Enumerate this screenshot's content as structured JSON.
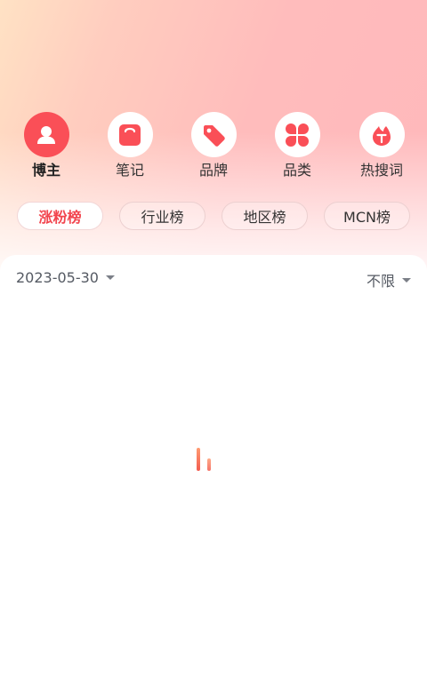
{
  "categories": [
    {
      "label": "博主",
      "icon": "user-icon",
      "active": true
    },
    {
      "label": "笔记",
      "icon": "note-icon",
      "active": false
    },
    {
      "label": "品牌",
      "icon": "tag-icon",
      "active": false
    },
    {
      "label": "品类",
      "icon": "clover-icon",
      "active": false
    },
    {
      "label": "热搜词",
      "icon": "hot-search-icon",
      "active": false
    }
  ],
  "sub_tabs": [
    {
      "label": "涨粉榜",
      "active": true
    },
    {
      "label": "行业榜",
      "active": false
    },
    {
      "label": "地区榜",
      "active": false
    },
    {
      "label": "MCN榜",
      "active": false
    }
  ],
  "filters": {
    "date": "2023-05-30",
    "range": "不限"
  },
  "loading": true,
  "colors": {
    "accent": "#fa4f57",
    "active_tab_text": "#f2454e",
    "header_gradient_start": "#ffe2c4",
    "header_gradient_end": "#ffb8bb"
  }
}
